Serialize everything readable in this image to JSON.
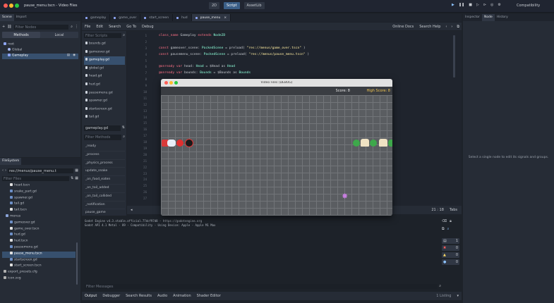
{
  "window": {
    "title": "pause_menu.tscn - Video Files"
  },
  "top_tabs": [
    "2D",
    "Script",
    "AssetLib"
  ],
  "top_right": {
    "renderer": "Compatibility"
  },
  "left_dock": {
    "top_tabs": [
      "Scene",
      "Import"
    ],
    "filter_placeholder": "Filter Nodes",
    "mode_buttons": [
      "Methods",
      "Local"
    ],
    "tree": [
      {
        "label": "root"
      },
      {
        "label": "Global"
      },
      {
        "label": "Gameplay"
      }
    ]
  },
  "filesystem": {
    "tab": "FileSystem",
    "path": "res://menus/pause_menu.t",
    "filter_placeholder": "Filter Files",
    "items": [
      "head.tscn",
      "snake_part.gd",
      "spawner.gd",
      "tail.gd",
      "tail.tscn",
      "menus",
      "gameover.gd",
      "game_over.tscn",
      "hud.gd",
      "hud.tscn",
      "pausemenu.gd",
      "pause_menu.tscn",
      "startscreen.gd",
      "start_screen.tscn",
      "export_presets.cfg",
      "icon.svg"
    ]
  },
  "editor_tabs": [
    "gameplay",
    "game_over",
    "start_screen",
    "hud",
    "pause_menu"
  ],
  "editor_menu": [
    "File",
    "Edit",
    "Search",
    "Go To",
    "Debug"
  ],
  "editor_menu_right": [
    "Online Docs",
    "Search Help"
  ],
  "scripts": {
    "filter_placeholder": "Filter Scripts",
    "items": [
      "bounds.gd",
      "gameover.gd",
      "gameplay.gd",
      "global.gd",
      "head.gd",
      "hud.gd",
      "pausemenu.gd",
      "spawner.gd",
      "startscreen.gd",
      "tail.gd"
    ],
    "current": "gameplay.gd",
    "methods_filter": "Filter Methods",
    "methods": [
      "_ready",
      "_process",
      "_physics_process",
      "update_snake",
      "_on_food_eaten",
      "_on_tail_added",
      "_on_tail_collided",
      "_notification",
      "pause_game"
    ]
  },
  "code": {
    "line_numbers": [
      "1",
      "2",
      "3",
      "4",
      "5",
      "6",
      "7",
      "8",
      "9",
      "10",
      "11",
      "12",
      "13",
      "14",
      "15",
      "16",
      "17",
      "18",
      "19",
      "20",
      "21",
      "22",
      "23",
      "24",
      "25",
      "26",
      "27"
    ],
    "lines": [
      {
        "parts": [
          [
            "kw",
            "class_name"
          ],
          [
            "",
            "Gameplay"
          ],
          [
            "kw",
            "extends"
          ],
          [
            "typ",
            "Node2D"
          ]
        ]
      },
      {
        "parts": []
      },
      {
        "parts": [
          [
            "kw",
            "const"
          ],
          [
            "",
            "gameover_scene:"
          ],
          [
            "typ",
            "PackedScene"
          ],
          [
            "",
            "= preload("
          ],
          [
            "str",
            "\"res://menus/game_over.tscn\""
          ],
          [
            "",
            ")"
          ]
        ]
      },
      {
        "parts": [
          [
            "kw",
            "const"
          ],
          [
            "",
            "pausemenu_scene:"
          ],
          [
            "typ",
            "PackedScene"
          ],
          [
            "",
            "= preload("
          ],
          [
            "str",
            "\"res://menus/pause_menu.tscn\""
          ],
          [
            "",
            ")"
          ]
        ]
      },
      {
        "parts": []
      },
      {
        "parts": [
          [
            "kw",
            "@onready var"
          ],
          [
            "",
            "head:"
          ],
          [
            "typ",
            "Head"
          ],
          [
            "",
            "= $Head as"
          ],
          [
            "typ",
            "Head"
          ]
        ]
      },
      {
        "parts": [
          [
            "kw",
            "@onready var"
          ],
          [
            "",
            "bounds:"
          ],
          [
            "typ",
            "Bounds"
          ],
          [
            "",
            "= $Bounds as"
          ],
          [
            "typ",
            "Bounds"
          ]
        ]
      }
    ],
    "status": [
      "21 : 18",
      "Tabs"
    ]
  },
  "output": {
    "lines": [
      "Godot Engine v4.3.stable.official.77dcf97d8 - https://godotengine.org",
      "Godot API 4.1 Metal - 89 - Compatibility - Using Device: Apple - Apple M1 Max"
    ],
    "filter_placeholder": "Filter Messages",
    "badge": "1 Listing",
    "bottom_tabs": [
      "Output",
      "Debugger",
      "Search Results",
      "Audio",
      "Animation",
      "Shader Editor"
    ],
    "counts": [
      "1",
      "0",
      "0",
      "0"
    ]
  },
  "game_window": {
    "title": "Video Files (DEBUG)",
    "score": "Score: 8",
    "high_score": "High Score: 8",
    "snake_segments": 4,
    "food_items": 3,
    "colors": {
      "grid_bg": "#5a5d61",
      "grid_line": "#727579",
      "topbar": "#3a3d42",
      "score": "#e8e8e8",
      "high_score": "#f1c552"
    }
  },
  "inspector": {
    "tabs": [
      "Inspector",
      "Node",
      "History"
    ],
    "message": "Select a single node to edit its signals and groups."
  },
  "colors": {
    "accent": "#478cbf",
    "selection": "#37506e",
    "bg": "#1d2229"
  }
}
